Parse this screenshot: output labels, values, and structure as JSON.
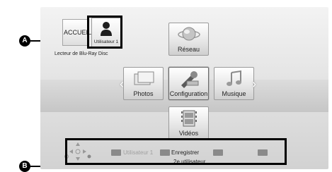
{
  "callouts": {
    "a": "A",
    "b": "B"
  },
  "home": {
    "label": "ACCUEIL",
    "user_label": "Utilisateur 1",
    "player_label": "Lecteur de Blu-Ray Disc"
  },
  "menu": {
    "network": "Réseau",
    "photos": "Photos",
    "configuration": "Configuration",
    "music": "Musique",
    "videos": "Vidéos"
  },
  "buttons": {
    "red_label": "Utilisateur 1",
    "green_label": "Enregistrer",
    "green_label_line2": "2e utilisateur",
    "yellow_label": "",
    "blue_label": ""
  },
  "icons": {
    "user": "user-icon",
    "network": "globe-icon",
    "photos": "photos-icon",
    "config": "tools-icon",
    "music": "music-note-icon",
    "video": "film-icon",
    "dpad": "dpad-icon"
  }
}
